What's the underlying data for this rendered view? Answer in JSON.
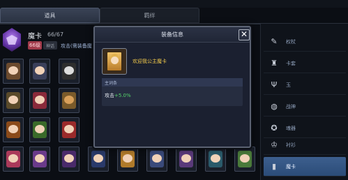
{
  "tabs": [
    {
      "label": "道具",
      "active": true
    },
    {
      "label": "羁绊",
      "active": false
    }
  ],
  "hero": {
    "name": "魔卡",
    "count": "66/67",
    "level": "66级",
    "tag": "神话",
    "attack_text": "攻击(需装备魔"
  },
  "sidebar": {
    "items": [
      {
        "label": "权杖",
        "icon": "✎"
      },
      {
        "label": "卡套",
        "icon": "♜"
      },
      {
        "label": "玉",
        "icon": "Ψ"
      },
      {
        "label": "战神",
        "icon": "◍"
      },
      {
        "label": "魂器",
        "icon": "✪"
      },
      {
        "label": "衬衫",
        "icon": "♔"
      },
      {
        "label": "魔卡",
        "icon": "▮",
        "active": true
      }
    ]
  },
  "modal": {
    "title": "装备信息",
    "close_symbol": "✕",
    "item_name": "欢迎我公主魔卡",
    "section_title": "主词条",
    "stat_label": "攻击",
    "stat_bonus": "+5.0%"
  },
  "colors": {
    "accent_blue": "#2b4c78",
    "item_name_gold": "#f0c84a",
    "bonus_green": "#54d26a",
    "level_red": "#a03a4a"
  }
}
